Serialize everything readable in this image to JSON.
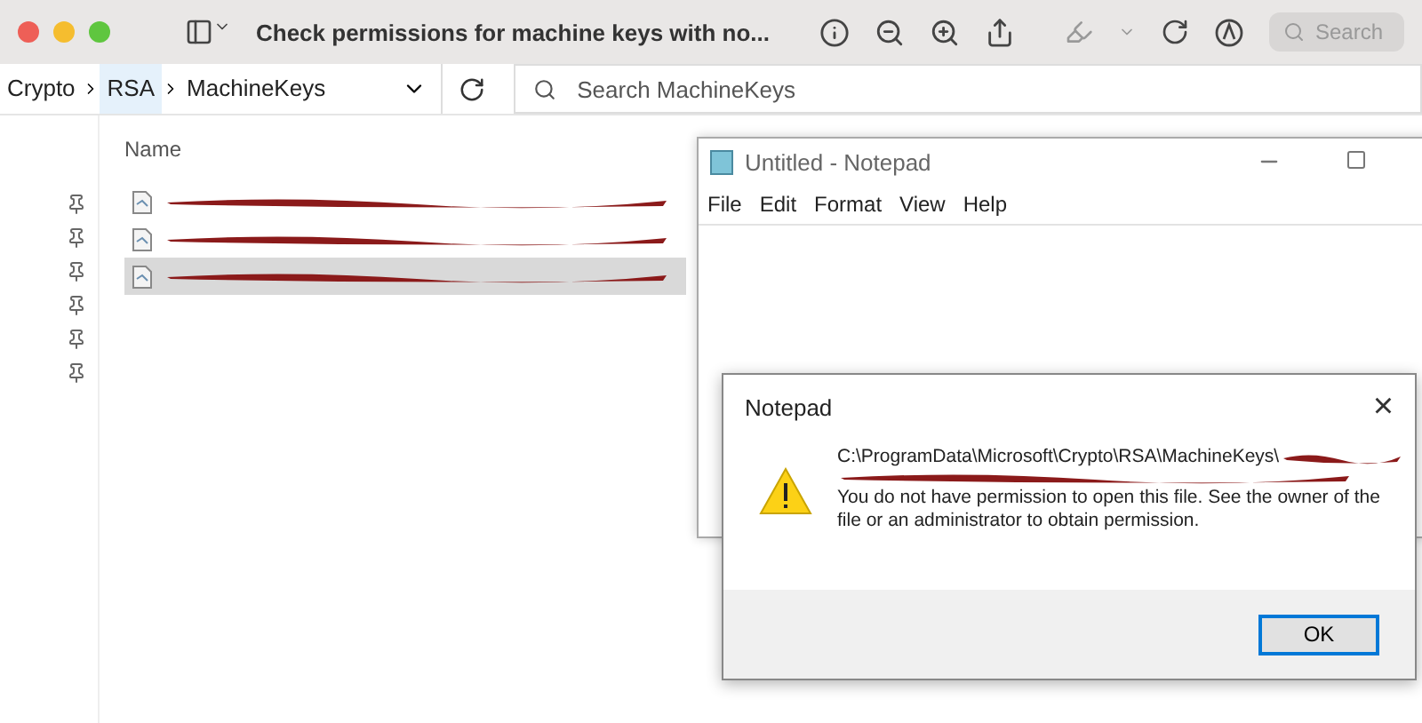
{
  "viewer": {
    "title": "Check permissions for machine keys with no...",
    "search": {
      "placeholder": "Search"
    }
  },
  "explorer": {
    "breadcrumb": [
      {
        "label": "Crypto",
        "selected": false
      },
      {
        "label": "RSA",
        "selected": true
      },
      {
        "label": "MachineKeys",
        "selected": false
      }
    ],
    "search": {
      "placeholder": "Search MachineKeys"
    },
    "column": "Name",
    "files": [
      {
        "selected": false
      },
      {
        "selected": false
      },
      {
        "selected": true
      }
    ]
  },
  "notepad": {
    "title": "Untitled - Notepad",
    "menu": [
      "File",
      "Edit",
      "Format",
      "View",
      "Help"
    ]
  },
  "dialog": {
    "title": "Notepad",
    "close": "×",
    "path": "C:\\ProgramData\\Microsoft\\Crypto\\RSA\\MachineKeys\\",
    "message": "You do not have permission to open this file.  See the owner of the file or an administrator to obtain permission.",
    "button": "OK"
  }
}
